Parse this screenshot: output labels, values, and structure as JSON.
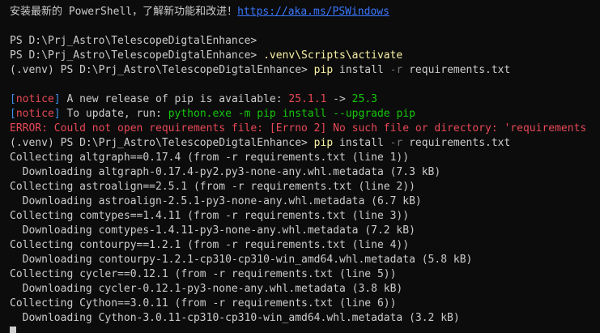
{
  "colors": {
    "background": "#0c0c0c",
    "foreground": "#cccccc",
    "link": "#3b78ff",
    "command": "#f9f1a5",
    "dim": "#767676",
    "notice": "#3b8eea",
    "error": "#e74856",
    "green": "#16c60c"
  },
  "banner": {
    "text": "安装最新的 PowerShell，了解新功能和改进！",
    "link": "https://aka.ms/PSWindows"
  },
  "prompt1": "PS D:\\Prj_Astro\\TelescopeDigtalEnhance>",
  "prompt2": {
    "ps": "PS D:\\Prj_Astro\\TelescopeDigtalEnhance>",
    "cmd": " .venv\\Scripts\\activate"
  },
  "prompt3": {
    "ps": "(.venv) PS D:\\Prj_Astro\\TelescopeDigtalEnhance>",
    "cmd": " pip",
    "arg1": " install",
    "flag": " -r",
    "arg2": " requirements.txt"
  },
  "notice1": {
    "open": "[",
    "tag": "notice",
    "close": "]",
    "text": " A new release of pip is available: ",
    "old": "25.1.1",
    "arrow": " -> ",
    "new": "25.3"
  },
  "notice2": {
    "open": "[",
    "tag": "notice",
    "close": "]",
    "text": " To update, run: ",
    "cmd": "python.exe -m pip install --upgrade pip"
  },
  "error": "ERROR: Could not open requirements file: [Errno 2] No such file or directory: 'requirements",
  "prompt4": {
    "ps": "(.venv) PS D:\\Prj_Astro\\TelescopeDigtalEnhance>",
    "cmd": " pip",
    "arg1": " install",
    "flag": " -r",
    "arg2": " requirements.txt"
  },
  "output": [
    "Collecting altgraph==0.17.4 (from -r requirements.txt (line 1))",
    "  Downloading altgraph-0.17.4-py2.py3-none-any.whl.metadata (7.3 kB)",
    "Collecting astroalign==2.5.1 (from -r requirements.txt (line 2))",
    "  Downloading astroalign-2.5.1-py3-none-any.whl.metadata (6.7 kB)",
    "Collecting comtypes==1.4.11 (from -r requirements.txt (line 3))",
    "  Downloading comtypes-1.4.11-py3-none-any.whl.metadata (7.2 kB)",
    "Collecting contourpy==1.2.1 (from -r requirements.txt (line 4))",
    "  Downloading contourpy-1.2.1-cp310-cp310-win_amd64.whl.metadata (5.8 kB)",
    "Collecting cycler==0.12.1 (from -r requirements.txt (line 5))",
    "  Downloading cycler-0.12.1-py3-none-any.whl.metadata (3.8 kB)",
    "Collecting Cython==3.0.11 (from -r requirements.txt (line 6))",
    "  Downloading Cython-3.0.11-cp310-cp310-win_amd64.whl.metadata (3.2 kB)"
  ]
}
